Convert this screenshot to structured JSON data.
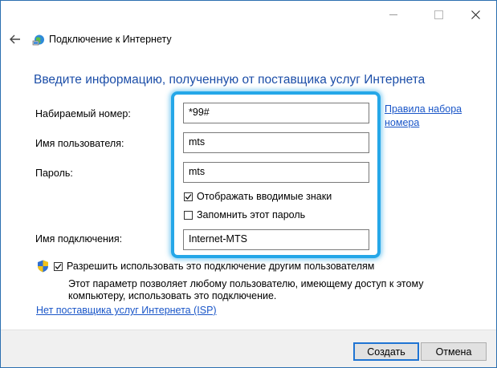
{
  "window": {
    "title": "Подключение к Интернету",
    "heading": "Введите информацию, полученную от поставщика услуг Интернета"
  },
  "form": {
    "dial_number": {
      "label": "Набираемый номер:",
      "value": "*99#"
    },
    "username": {
      "label": "Имя пользователя:",
      "value": "mts"
    },
    "password": {
      "label": "Пароль:",
      "value": "mts"
    },
    "show_chars": {
      "label": "Отображать вводимые знаки",
      "checked": true
    },
    "remember_password": {
      "label": "Запомнить этот пароль",
      "checked": false
    },
    "connection_name": {
      "label": "Имя подключения:",
      "value": "Internet-MTS"
    },
    "dial_rules_link": "Правила набора номера",
    "allow_others": {
      "label": "Разрешить использовать это подключение другим пользователям",
      "checked": true
    },
    "allow_others_desc": "Этот параметр позволяет любому пользователю, имеющему доступ к этому компьютеру, использовать это подключение."
  },
  "no_isp_link": "Нет поставщика услуг Интернета (ISP)",
  "buttons": {
    "create": "Создать",
    "cancel": "Отмена"
  },
  "colors": {
    "heading": "#1c4ea8",
    "link": "#1a56c8",
    "highlight": "#25a7e8"
  }
}
